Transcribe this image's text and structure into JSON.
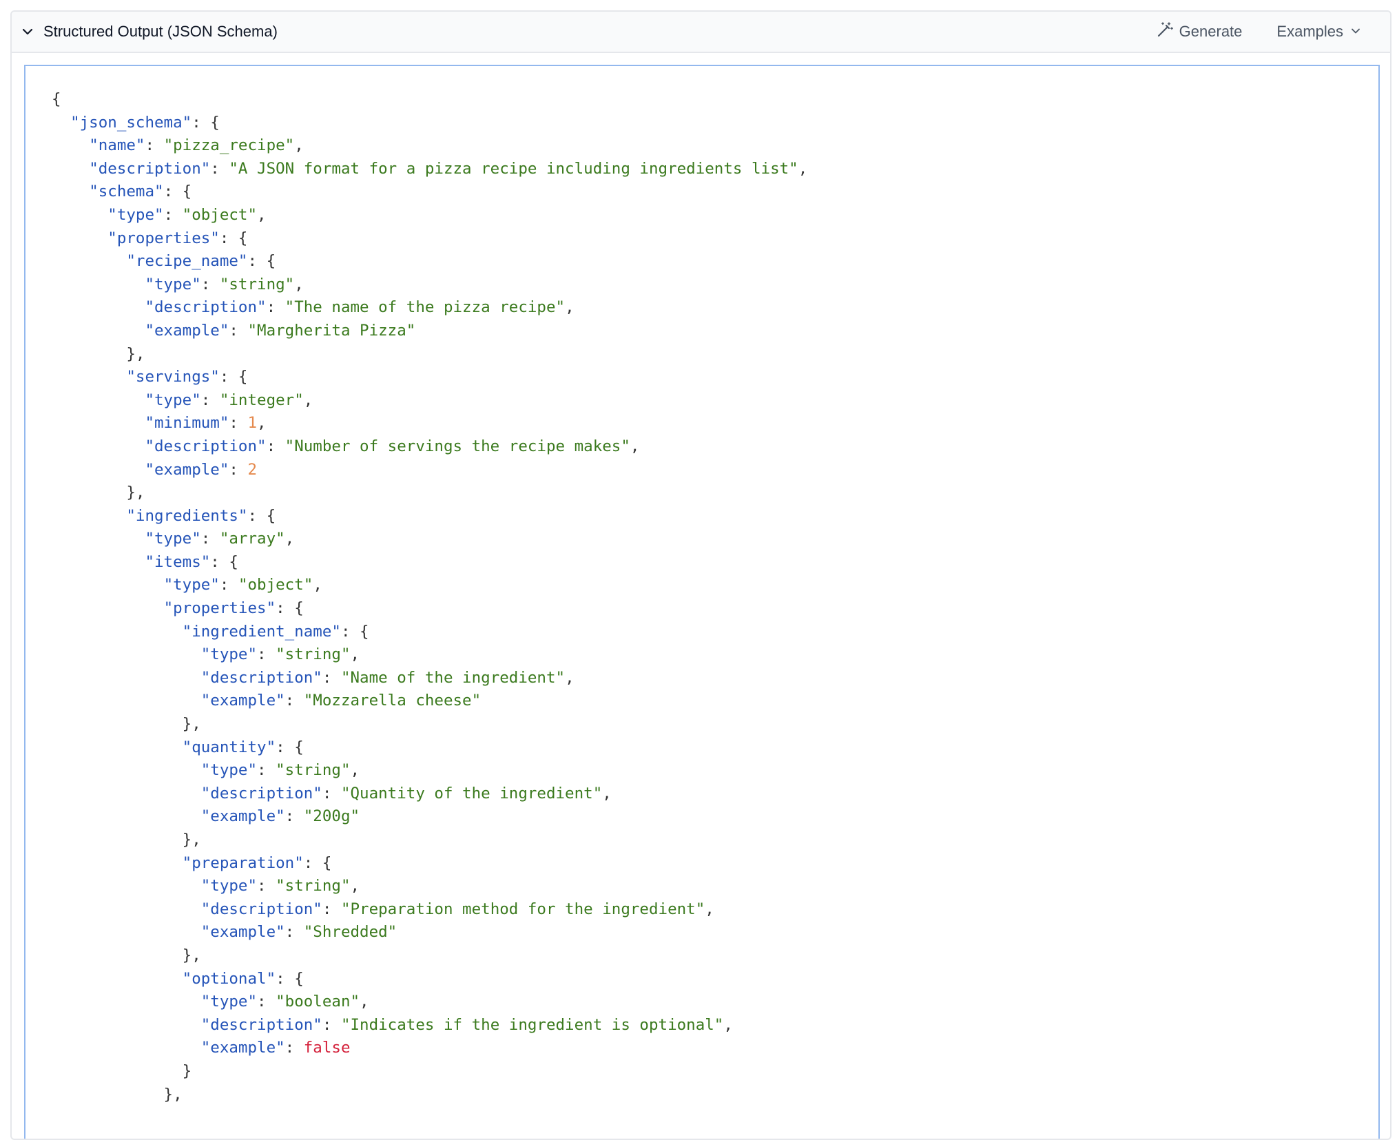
{
  "header": {
    "title": "Structured Output (JSON Schema)",
    "generate_label": "Generate",
    "examples_label": "Examples"
  },
  "icons": {
    "toggle": "chevron-down-icon",
    "generate": "magic-wand-icon",
    "examples": "chevron-down-icon"
  },
  "colors": {
    "key": "#2554b8",
    "string": "#3b7a1e",
    "number": "#e58a4e",
    "boolean": "#d4213b",
    "punctuation": "#333333",
    "editor_border": "#93b8ee"
  },
  "editor": {
    "lines": [
      [
        [
          "p",
          "{"
        ]
      ],
      [
        [
          "p",
          "  "
        ],
        [
          "k",
          "\"json_schema\""
        ],
        [
          "p",
          ": {"
        ]
      ],
      [
        [
          "p",
          "    "
        ],
        [
          "k",
          "\"name\""
        ],
        [
          "p",
          ": "
        ],
        [
          "s",
          "\"pizza_recipe\""
        ],
        [
          "p",
          ","
        ]
      ],
      [
        [
          "p",
          "    "
        ],
        [
          "k",
          "\"description\""
        ],
        [
          "p",
          ": "
        ],
        [
          "s",
          "\"A JSON format for a pizza recipe including ingredients list\""
        ],
        [
          "p",
          ","
        ]
      ],
      [
        [
          "p",
          "    "
        ],
        [
          "k",
          "\"schema\""
        ],
        [
          "p",
          ": {"
        ]
      ],
      [
        [
          "p",
          "      "
        ],
        [
          "k",
          "\"type\""
        ],
        [
          "p",
          ": "
        ],
        [
          "s",
          "\"object\""
        ],
        [
          "p",
          ","
        ]
      ],
      [
        [
          "p",
          "      "
        ],
        [
          "k",
          "\"properties\""
        ],
        [
          "p",
          ": {"
        ]
      ],
      [
        [
          "p",
          "        "
        ],
        [
          "k",
          "\"recipe_name\""
        ],
        [
          "p",
          ": {"
        ]
      ],
      [
        [
          "p",
          "          "
        ],
        [
          "k",
          "\"type\""
        ],
        [
          "p",
          ": "
        ],
        [
          "s",
          "\"string\""
        ],
        [
          "p",
          ","
        ]
      ],
      [
        [
          "p",
          "          "
        ],
        [
          "k",
          "\"description\""
        ],
        [
          "p",
          ": "
        ],
        [
          "s",
          "\"The name of the pizza recipe\""
        ],
        [
          "p",
          ","
        ]
      ],
      [
        [
          "p",
          "          "
        ],
        [
          "k",
          "\"example\""
        ],
        [
          "p",
          ": "
        ],
        [
          "s",
          "\"Margherita Pizza\""
        ]
      ],
      [
        [
          "p",
          "        },"
        ]
      ],
      [
        [
          "p",
          "        "
        ],
        [
          "k",
          "\"servings\""
        ],
        [
          "p",
          ": {"
        ]
      ],
      [
        [
          "p",
          "          "
        ],
        [
          "k",
          "\"type\""
        ],
        [
          "p",
          ": "
        ],
        [
          "s",
          "\"integer\""
        ],
        [
          "p",
          ","
        ]
      ],
      [
        [
          "p",
          "          "
        ],
        [
          "k",
          "\"minimum\""
        ],
        [
          "p",
          ": "
        ],
        [
          "n",
          "1"
        ],
        [
          "p",
          ","
        ]
      ],
      [
        [
          "p",
          "          "
        ],
        [
          "k",
          "\"description\""
        ],
        [
          "p",
          ": "
        ],
        [
          "s",
          "\"Number of servings the recipe makes\""
        ],
        [
          "p",
          ","
        ]
      ],
      [
        [
          "p",
          "          "
        ],
        [
          "k",
          "\"example\""
        ],
        [
          "p",
          ": "
        ],
        [
          "n",
          "2"
        ]
      ],
      [
        [
          "p",
          "        },"
        ]
      ],
      [
        [
          "p",
          "        "
        ],
        [
          "k",
          "\"ingredients\""
        ],
        [
          "p",
          ": {"
        ]
      ],
      [
        [
          "p",
          "          "
        ],
        [
          "k",
          "\"type\""
        ],
        [
          "p",
          ": "
        ],
        [
          "s",
          "\"array\""
        ],
        [
          "p",
          ","
        ]
      ],
      [
        [
          "p",
          "          "
        ],
        [
          "k",
          "\"items\""
        ],
        [
          "p",
          ": {"
        ]
      ],
      [
        [
          "p",
          "            "
        ],
        [
          "k",
          "\"type\""
        ],
        [
          "p",
          ": "
        ],
        [
          "s",
          "\"object\""
        ],
        [
          "p",
          ","
        ]
      ],
      [
        [
          "p",
          "            "
        ],
        [
          "k",
          "\"properties\""
        ],
        [
          "p",
          ": {"
        ]
      ],
      [
        [
          "p",
          "              "
        ],
        [
          "k",
          "\"ingredient_name\""
        ],
        [
          "p",
          ": {"
        ]
      ],
      [
        [
          "p",
          "                "
        ],
        [
          "k",
          "\"type\""
        ],
        [
          "p",
          ": "
        ],
        [
          "s",
          "\"string\""
        ],
        [
          "p",
          ","
        ]
      ],
      [
        [
          "p",
          "                "
        ],
        [
          "k",
          "\"description\""
        ],
        [
          "p",
          ": "
        ],
        [
          "s",
          "\"Name of the ingredient\""
        ],
        [
          "p",
          ","
        ]
      ],
      [
        [
          "p",
          "                "
        ],
        [
          "k",
          "\"example\""
        ],
        [
          "p",
          ": "
        ],
        [
          "s",
          "\"Mozzarella cheese\""
        ]
      ],
      [
        [
          "p",
          "              },"
        ]
      ],
      [
        [
          "p",
          "              "
        ],
        [
          "k",
          "\"quantity\""
        ],
        [
          "p",
          ": {"
        ]
      ],
      [
        [
          "p",
          "                "
        ],
        [
          "k",
          "\"type\""
        ],
        [
          "p",
          ": "
        ],
        [
          "s",
          "\"string\""
        ],
        [
          "p",
          ","
        ]
      ],
      [
        [
          "p",
          "                "
        ],
        [
          "k",
          "\"description\""
        ],
        [
          "p",
          ": "
        ],
        [
          "s",
          "\"Quantity of the ingredient\""
        ],
        [
          "p",
          ","
        ]
      ],
      [
        [
          "p",
          "                "
        ],
        [
          "k",
          "\"example\""
        ],
        [
          "p",
          ": "
        ],
        [
          "s",
          "\"200g\""
        ]
      ],
      [
        [
          "p",
          "              },"
        ]
      ],
      [
        [
          "p",
          "              "
        ],
        [
          "k",
          "\"preparation\""
        ],
        [
          "p",
          ": {"
        ]
      ],
      [
        [
          "p",
          "                "
        ],
        [
          "k",
          "\"type\""
        ],
        [
          "p",
          ": "
        ],
        [
          "s",
          "\"string\""
        ],
        [
          "p",
          ","
        ]
      ],
      [
        [
          "p",
          "                "
        ],
        [
          "k",
          "\"description\""
        ],
        [
          "p",
          ": "
        ],
        [
          "s",
          "\"Preparation method for the ingredient\""
        ],
        [
          "p",
          ","
        ]
      ],
      [
        [
          "p",
          "                "
        ],
        [
          "k",
          "\"example\""
        ],
        [
          "p",
          ": "
        ],
        [
          "s",
          "\"Shredded\""
        ]
      ],
      [
        [
          "p",
          "              },"
        ]
      ],
      [
        [
          "p",
          "              "
        ],
        [
          "k",
          "\"optional\""
        ],
        [
          "p",
          ": {"
        ]
      ],
      [
        [
          "p",
          "                "
        ],
        [
          "k",
          "\"type\""
        ],
        [
          "p",
          ": "
        ],
        [
          "s",
          "\"boolean\""
        ],
        [
          "p",
          ","
        ]
      ],
      [
        [
          "p",
          "                "
        ],
        [
          "k",
          "\"description\""
        ],
        [
          "p",
          ": "
        ],
        [
          "s",
          "\"Indicates if the ingredient is optional\""
        ],
        [
          "p",
          ","
        ]
      ],
      [
        [
          "p",
          "                "
        ],
        [
          "k",
          "\"example\""
        ],
        [
          "p",
          ": "
        ],
        [
          "b",
          "false"
        ]
      ],
      [
        [
          "p",
          "              }"
        ]
      ],
      [
        [
          "p",
          "            },"
        ]
      ]
    ]
  }
}
